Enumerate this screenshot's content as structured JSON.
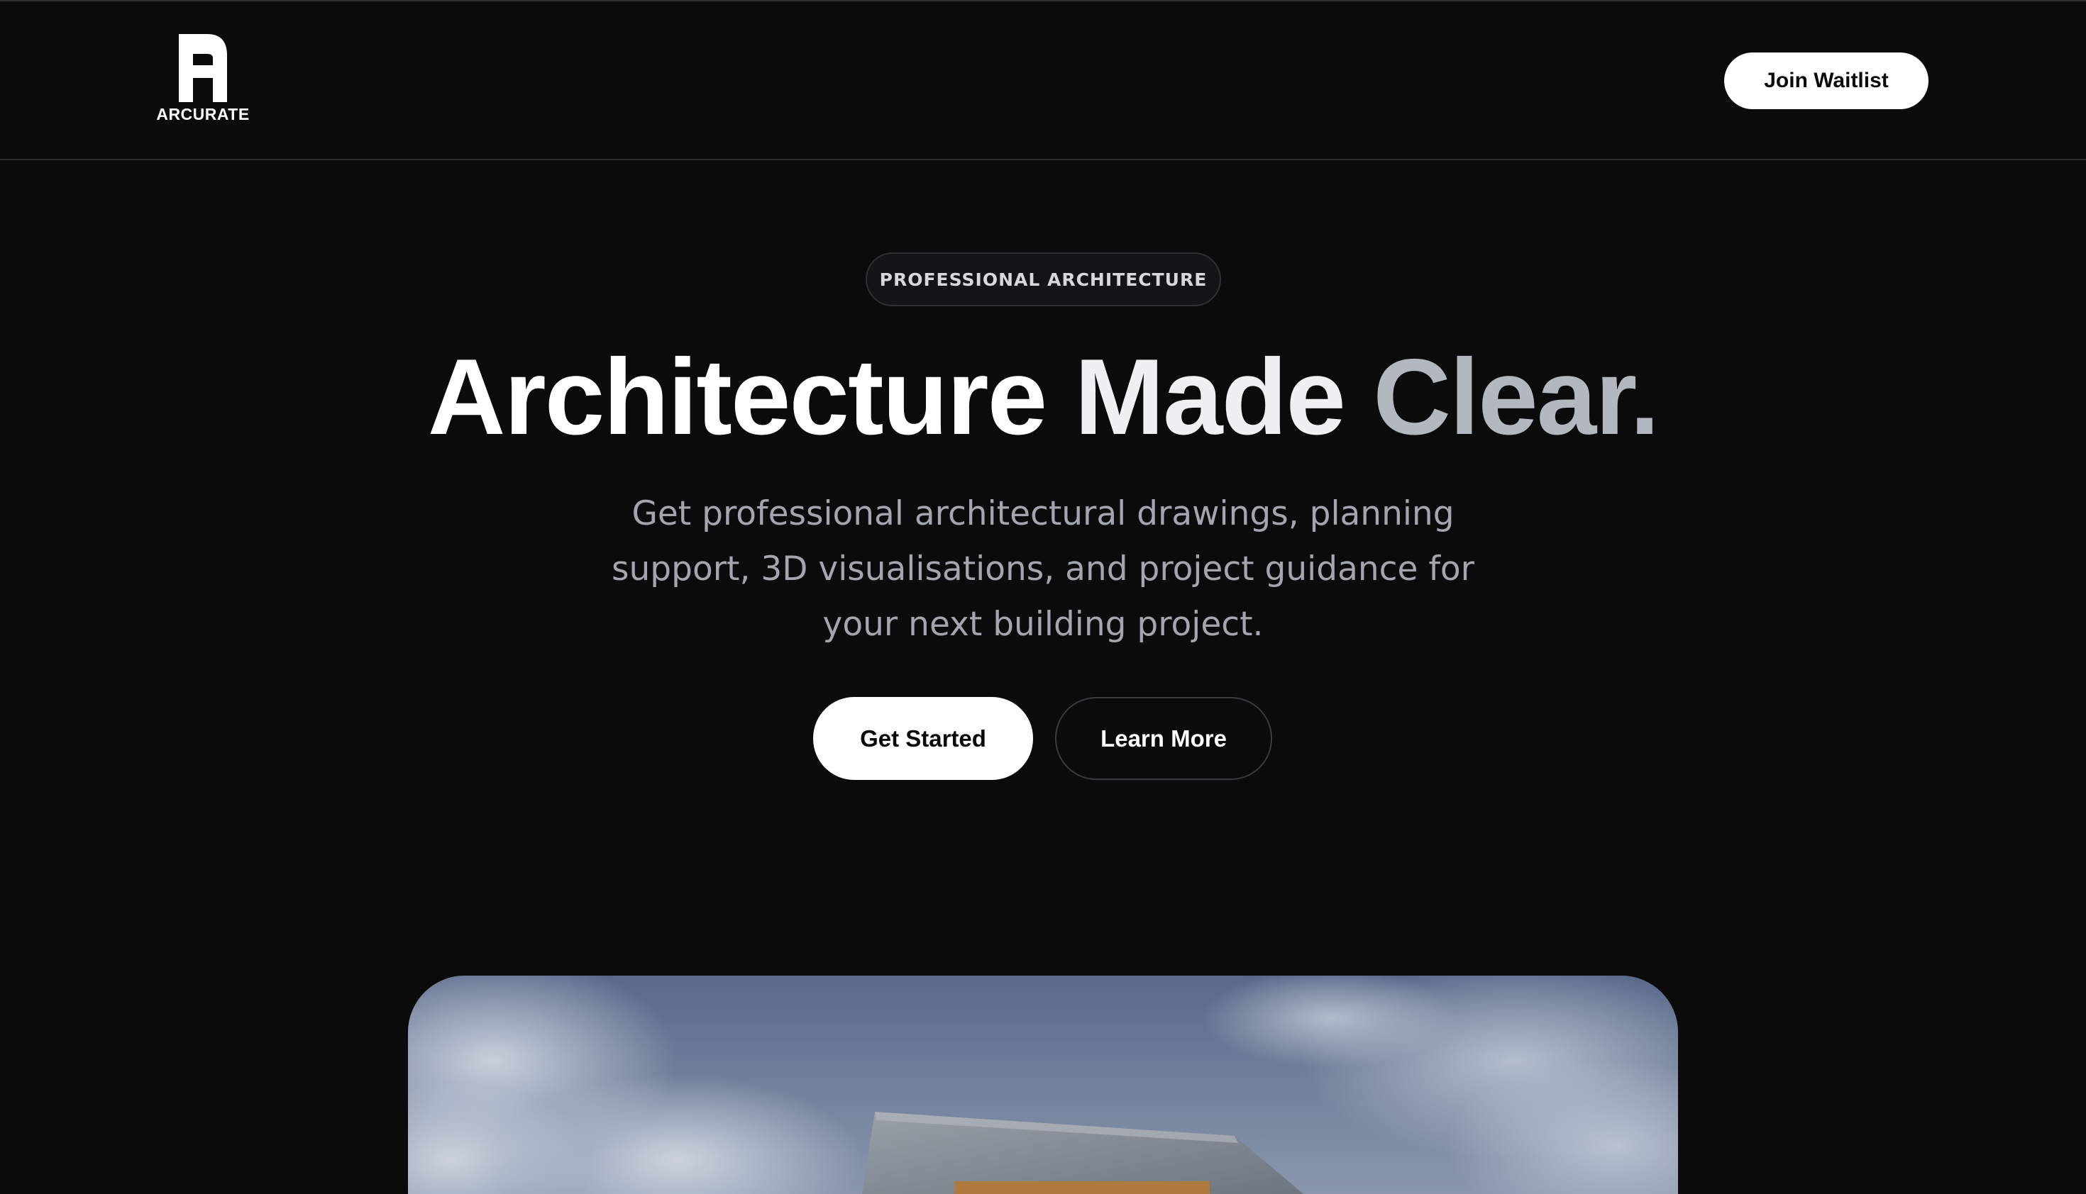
{
  "header": {
    "logo_text": "ARCURATE",
    "join_label": "Join Waitlist"
  },
  "hero": {
    "badge": "PROFESSIONAL ARCHITECTURE",
    "title_part1": "Architecture",
    "title_part2": "Made",
    "title_part3": "Clear.",
    "description": "Get professional architectural drawings, planning support, 3D visualisations, and project guidance for your next building project.",
    "primary_cta": "Get Started",
    "secondary_cta": "Learn More"
  },
  "colors": {
    "background": "#0b0b0c",
    "accent_text": "#b3b7c0",
    "button_bg": "#ffffff",
    "muted_text": "#a3a6ae"
  }
}
